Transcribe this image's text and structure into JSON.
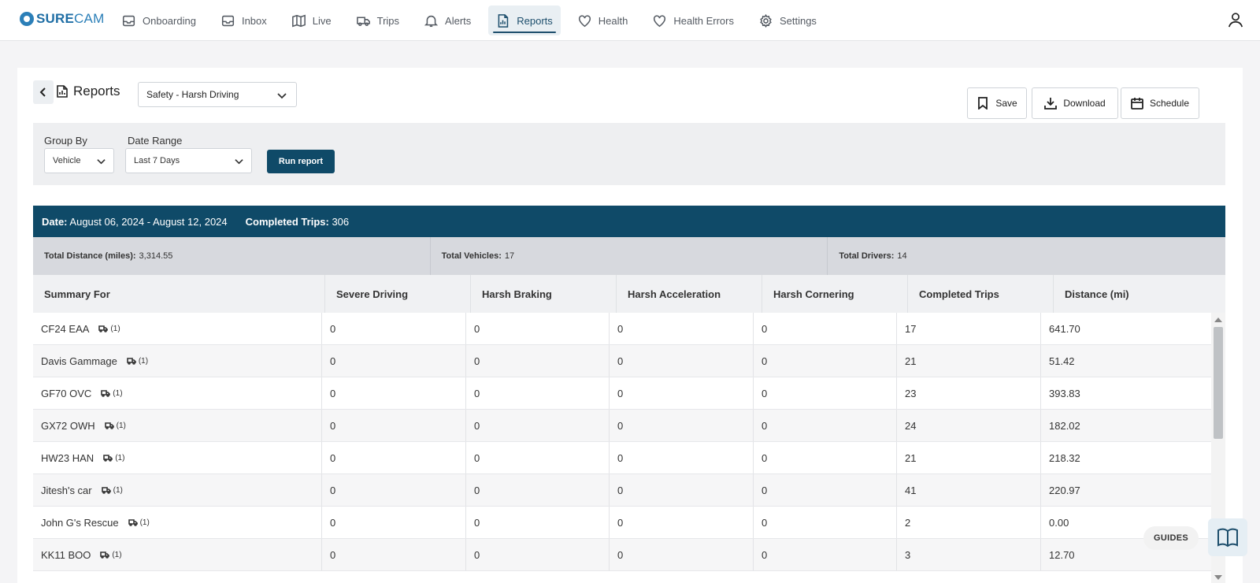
{
  "app": {
    "brand_bold": "SURE",
    "brand_rest": "CAM"
  },
  "nav": [
    {
      "label": "Onboarding",
      "icon": "inbox-check-icon"
    },
    {
      "label": "Inbox",
      "icon": "inbox-icon"
    },
    {
      "label": "Live",
      "icon": "map-icon"
    },
    {
      "label": "Trips",
      "icon": "truck-icon"
    },
    {
      "label": "Alerts",
      "icon": "bell-icon"
    },
    {
      "label": "Reports",
      "icon": "report-icon",
      "active": true
    },
    {
      "label": "Health",
      "icon": "heart-icon"
    },
    {
      "label": "Health Errors",
      "icon": "heart-icon"
    },
    {
      "label": "Settings",
      "icon": "gear-icon"
    }
  ],
  "header": {
    "title": "Reports",
    "report_type": "Safety - Harsh Driving",
    "actions": {
      "save": "Save",
      "download": "Download",
      "schedule": "Schedule"
    }
  },
  "filters": {
    "group_by_label": "Group By",
    "group_by_value": "Vehicle",
    "date_range_label": "Date Range",
    "date_range_value": "Last 7 Days",
    "run_label": "Run report"
  },
  "summary": {
    "date_label": "Date:",
    "date_value": "August 06, 2024 - August 12, 2024",
    "trips_label": "Completed Trips:",
    "trips_value": "306"
  },
  "totals": {
    "distance_label": "Total Distance (miles):",
    "distance_value": "3,314.55",
    "vehicles_label": "Total Vehicles:",
    "vehicles_value": "17",
    "drivers_label": "Total Drivers:",
    "drivers_value": "14"
  },
  "table": {
    "columns": [
      "Summary For",
      "Severe Driving",
      "Harsh Braking",
      "Harsh Acceleration",
      "Harsh Cornering",
      "Completed Trips",
      "Distance (mi)"
    ],
    "rows": [
      {
        "name": "CF24 EAA",
        "count": "(1)",
        "severe": "0",
        "braking": "0",
        "accel": "0",
        "cornering": "0",
        "trips": "17",
        "distance": "641.70"
      },
      {
        "name": "Davis Gammage",
        "count": "(1)",
        "severe": "0",
        "braking": "0",
        "accel": "0",
        "cornering": "0",
        "trips": "21",
        "distance": "51.42"
      },
      {
        "name": "GF70 OVC",
        "count": "(1)",
        "severe": "0",
        "braking": "0",
        "accel": "0",
        "cornering": "0",
        "trips": "23",
        "distance": "393.83"
      },
      {
        "name": "GX72 OWH",
        "count": "(1)",
        "severe": "0",
        "braking": "0",
        "accel": "0",
        "cornering": "0",
        "trips": "24",
        "distance": "182.02"
      },
      {
        "name": "HW23 HAN",
        "count": "(1)",
        "severe": "0",
        "braking": "0",
        "accel": "0",
        "cornering": "0",
        "trips": "21",
        "distance": "218.32"
      },
      {
        "name": "Jitesh's car",
        "count": "(1)",
        "severe": "0",
        "braking": "0",
        "accel": "0",
        "cornering": "0",
        "trips": "41",
        "distance": "220.97"
      },
      {
        "name": "John G's Rescue",
        "count": "(1)",
        "severe": "0",
        "braking": "0",
        "accel": "0",
        "cornering": "0",
        "trips": "2",
        "distance": "0.00"
      },
      {
        "name": "KK11 BOO",
        "count": "(1)",
        "severe": "0",
        "braking": "0",
        "accel": "0",
        "cornering": "0",
        "trips": "3",
        "distance": "12.70"
      }
    ]
  },
  "guides": {
    "label": "GUIDES"
  }
}
